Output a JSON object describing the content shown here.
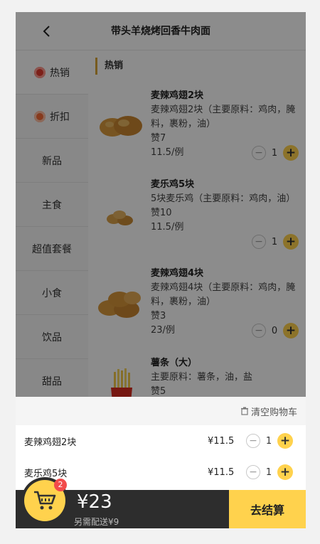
{
  "header": {
    "title": "带头羊烧烤回香牛肉面"
  },
  "sidebar": {
    "items": [
      {
        "label": "热销",
        "icon": "hot-icon"
      },
      {
        "label": "折扣",
        "icon": "discount-icon"
      },
      {
        "label": "新品"
      },
      {
        "label": "主食"
      },
      {
        "label": "超值套餐"
      },
      {
        "label": "小食"
      },
      {
        "label": "饮品"
      },
      {
        "label": "甜品"
      }
    ]
  },
  "main": {
    "section_title": "热销",
    "items": [
      {
        "name": "麦辣鸡翅2块",
        "desc": "麦辣鸡翅2块（主要原料：鸡肉，腌料，裹粉，油）",
        "likes": "赞7",
        "price": "11.5/例",
        "qty": "1"
      },
      {
        "name": "麦乐鸡5块",
        "desc": "5块麦乐鸡（主要原料：鸡肉，油）",
        "likes": "赞10",
        "price": "11.5/例",
        "qty": "1"
      },
      {
        "name": "麦辣鸡翅4块",
        "desc": "麦辣鸡翅4块（主要原料：鸡肉，腌料，裹粉，油）",
        "likes": "赞3",
        "price": "23/例",
        "qty": "0"
      },
      {
        "name": "薯条（大）",
        "desc": "主要原料：薯条，油，盐",
        "likes": "赞5",
        "price": "",
        "qty": ""
      }
    ]
  },
  "cart": {
    "clear_label": "清空购物车",
    "items": [
      {
        "name": "麦辣鸡翅2块",
        "price": "¥11.5",
        "qty": "1"
      },
      {
        "name": "麦乐鸡5块",
        "price": "¥11.5",
        "qty": "1"
      }
    ],
    "badge": "2",
    "total": "¥23",
    "delivery": "另需配送¥9",
    "checkout_label": "去结算"
  },
  "colors": {
    "accent": "#ffd24d",
    "bar": "#2d2d2d",
    "badge": "#f24b4b"
  }
}
